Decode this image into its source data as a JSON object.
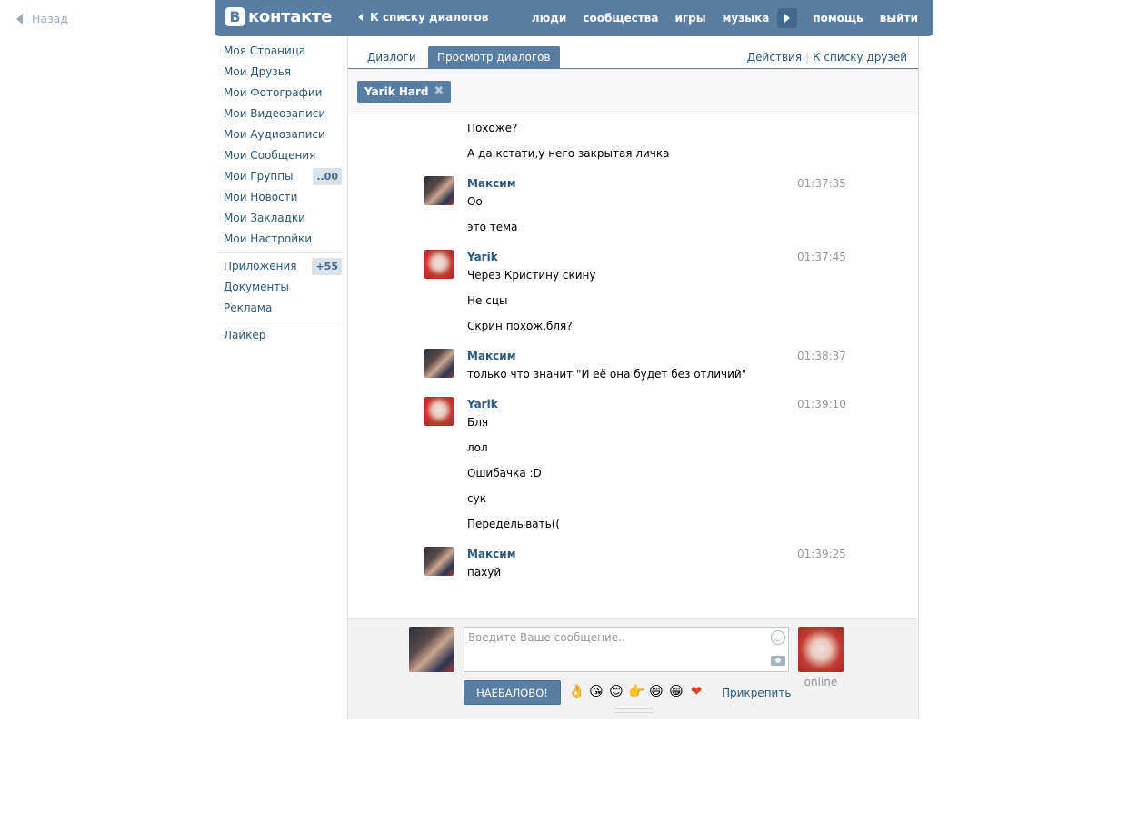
{
  "back": {
    "label": "Назад"
  },
  "header": {
    "logo_letter": "В",
    "logo_text": "контакте",
    "back_link": "К списку диалогов",
    "nav": [
      "люди",
      "сообщества",
      "игры",
      "музыка",
      "помощь",
      "выйти"
    ]
  },
  "sidebar": {
    "items": [
      {
        "label": "Моя Страница"
      },
      {
        "label": "Мои Друзья"
      },
      {
        "label": "Мои Фотографии"
      },
      {
        "label": "Мои Видеозаписи"
      },
      {
        "label": "Мои Аудиозаписи"
      },
      {
        "label": "Мои Сообщения"
      },
      {
        "label": "Мои Группы",
        "badge": "..00"
      },
      {
        "label": "Мои Новости"
      },
      {
        "label": "Мои Закладки"
      },
      {
        "label": "Мои Настройки"
      }
    ],
    "items2": [
      {
        "label": "Приложения",
        "badge": "+55"
      },
      {
        "label": "Документы"
      },
      {
        "label": "Реклама"
      }
    ],
    "items3": [
      {
        "label": "Лайкер"
      }
    ]
  },
  "tabs": {
    "dialogs": "Диалоги",
    "view": "Просмотр диалогов",
    "actions": "Действия",
    "separator": "|",
    "friends": "К списку друзей"
  },
  "filter": {
    "chip": "Yarik Hard",
    "chip_close": "✖"
  },
  "messages": {
    "pre": [
      "Похоже?",
      "А да,кстати,у него закрытая личка"
    ],
    "groups": [
      {
        "author": "Максим",
        "time": "01:37:35",
        "lines": [
          "Оо",
          "это тема"
        ]
      },
      {
        "author": "Yarik",
        "time": "01:37:45",
        "lines": [
          "Через Кристину скину",
          "Не сцы",
          "Скрин похож,бля?"
        ]
      },
      {
        "author": "Максим",
        "time": "01:38:37",
        "lines": [
          "только что значит \"И её она будет без отличий\""
        ]
      },
      {
        "author": "Yarik",
        "time": "01:39:10",
        "lines": [
          "Бля",
          "лол",
          "Ошибачка :D",
          "сук",
          "Переделывать(("
        ]
      },
      {
        "author": "Максим",
        "time": "01:39:25",
        "lines": [
          "пахуй"
        ]
      }
    ]
  },
  "composer": {
    "placeholder": "Введите Ваше сообщение..",
    "send_label": "НАЕБАЛОВО!",
    "attach_label": "Прикрепить",
    "peer_status": "online",
    "emojis": [
      "👌",
      "😘",
      "😊",
      "👉",
      "😄",
      "😁",
      "❤"
    ]
  },
  "colors": {
    "brand": "#597da3",
    "link": "#2b587a",
    "muted": "#999999"
  }
}
